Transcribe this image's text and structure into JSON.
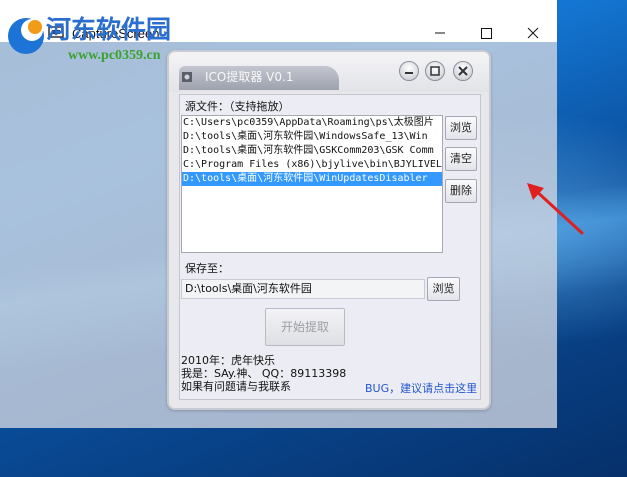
{
  "capture_window": {
    "title": "CaptureScreen"
  },
  "watermark": {
    "site_name": "河东软件园",
    "url": "www.pc0359.cn"
  },
  "dialog": {
    "title": "ICO提取器 V0.1",
    "source_label": "源文件：（支持拖放）",
    "files": [
      "C:\\Users\\pc0359\\AppData\\Roaming\\ps\\太极图片",
      "D:\\tools\\桌面\\河东软件园\\WindowsSafe_13\\Win",
      "D:\\tools\\桌面\\河东软件园\\GSKComm203\\GSK Comm",
      "C:\\Program Files (x86)\\bjylive\\bin\\BJYLIVEL",
      "D:\\tools\\桌面\\河东软件园\\WinUpdatesDisabler"
    ],
    "selected_index": 4,
    "browse_label": "浏览",
    "clear_label": "清空",
    "delete_label": "删除",
    "save_label": "保存至：",
    "save_path": "D:\\tools\\桌面\\河东软件园",
    "save_browse_label": "浏览",
    "start_label": "开始提取",
    "footer_line1": "2010年：虎年快乐",
    "footer_line2": "我是：SAy.神、 QQ：89113398",
    "footer_line3": "如果有问题请与我联系",
    "bug_link": "BUG，建议请点击这里"
  },
  "colors": {
    "selection": "#3399ff",
    "link": "#2255cc",
    "annotation_arrow": "#e02020"
  }
}
